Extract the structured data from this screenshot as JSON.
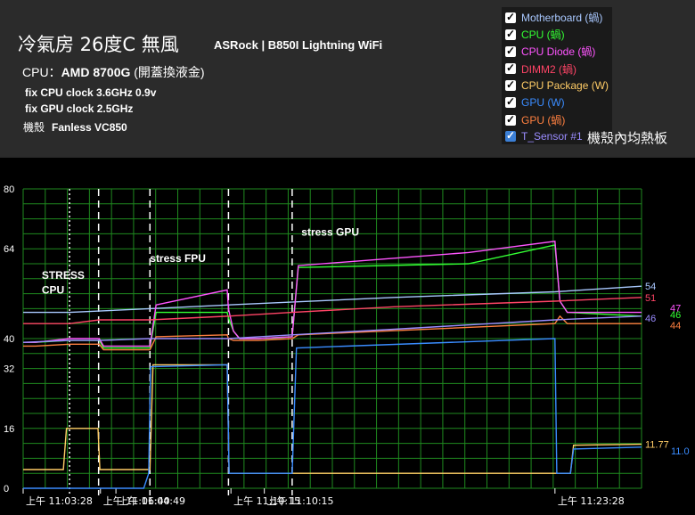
{
  "header": {
    "title": "冷氣房 26度C 無風",
    "board": "ASRock | B850I Lightning WiFi",
    "cpu_label": "CPU：",
    "cpu_model": "AMD 8700G",
    "cpu_cooler": "(開蓋換液金)",
    "line1": "fix CPU clock 3.6GHz  0.9v",
    "line2": "fix GPU clock 2.5GHz",
    "case_label": "機殼",
    "case_value": "Fanless VC850",
    "sensor_note": "機殼內均熱板"
  },
  "legend": [
    {
      "label": "Motherboard (蝸)",
      "color": "#a9c8ff",
      "checked": true
    },
    {
      "label": "CPU (蝸)",
      "color": "#33ff33",
      "checked": true
    },
    {
      "label": "CPU Diode (蝸)",
      "color": "#ff55ff",
      "checked": true
    },
    {
      "label": "DIMM2 (蝸)",
      "color": "#ff4466",
      "checked": true
    },
    {
      "label": "CPU Package (W)",
      "color": "#ffcc66",
      "checked": true
    },
    {
      "label": "GPU (W)",
      "color": "#3a8cff",
      "checked": true
    },
    {
      "label": "GPU (蝸)",
      "color": "#ff8040",
      "checked": true
    },
    {
      "label": "T_Sensor #1",
      "color": "#9a8cff",
      "checked": true
    }
  ],
  "chart_data": {
    "type": "line",
    "xlim": [
      0,
      100
    ],
    "ylim": [
      0,
      80
    ],
    "yticks": [
      0,
      16,
      32,
      40,
      64,
      80
    ],
    "x_tick_labels": [
      {
        "x": 0,
        "label": "上午 11:03:28"
      },
      {
        "x": 12.5,
        "label": "上午 11:06:40"
      },
      {
        "x": 15,
        "label": "上午 11:04:49"
      },
      {
        "x": 33.6,
        "label": "上午 11:10:15"
      },
      {
        "x": 39,
        "label": "上午 11:10:15"
      },
      {
        "x": 86,
        "label": "上午 11:23:28"
      }
    ],
    "annotations": [
      {
        "text": "STRESS",
        "x": 3,
        "y": 56
      },
      {
        "text": "CPU",
        "x": 3,
        "y": 52
      },
      {
        "text": "stress FPU",
        "x": 20.5,
        "y": 60.5
      },
      {
        "text": "stress  GPU",
        "x": 45,
        "y": 67.5
      }
    ],
    "markers": [
      {
        "x": 7.5,
        "style": "dotted"
      },
      {
        "x": 12.2,
        "style": "dashed"
      },
      {
        "x": 20.5,
        "style": "dashed"
      },
      {
        "x": 33.2,
        "style": "dashed"
      },
      {
        "x": 43.5,
        "style": "dashed"
      }
    ],
    "end_labels": [
      {
        "text": "54",
        "y": 54,
        "color": "#a9c8ff"
      },
      {
        "text": "51",
        "y": 51,
        "color": "#ff4466"
      },
      {
        "text": "47",
        "y": 47,
        "color": "#ff55ff"
      },
      {
        "text": "46",
        "y": 46,
        "color": "#33ff33"
      },
      {
        "text": "46",
        "y": 45.5,
        "color": "#9a8cff"
      },
      {
        "text": "44",
        "y": 44,
        "color": "#ff8040"
      },
      {
        "text": "11.77",
        "y": 11.77,
        "color": "#ffcc66"
      },
      {
        "text": "11.0",
        "y": 11.0,
        "color": "#3a8cff"
      }
    ],
    "series": [
      {
        "name": "Motherboard (蝸)",
        "color": "#a9c8ff",
        "x": [
          0,
          7.5,
          20.5,
          33.2,
          60,
          86,
          100
        ],
        "y": [
          47,
          47,
          48,
          49,
          51,
          52.5,
          54
        ]
      },
      {
        "name": "CPU (蝸)",
        "color": "#33ff33",
        "x": [
          0,
          2,
          7.5,
          12.3,
          13,
          20.5,
          21.5,
          33,
          33.2,
          34,
          35,
          38,
          43.5,
          44.5,
          72,
          86,
          86.8,
          88,
          100
        ],
        "y": [
          39,
          39,
          39.5,
          39.5,
          37.5,
          37.5,
          47,
          47,
          45.5,
          42,
          40,
          40,
          40.5,
          59,
          60,
          65,
          50,
          47,
          46
        ]
      },
      {
        "name": "CPU Diode (蝸)",
        "color": "#ff55ff",
        "x": [
          0,
          2,
          7.5,
          12.3,
          13,
          20.5,
          21.5,
          33,
          33.2,
          34,
          35,
          38,
          43.5,
          44.5,
          72,
          86,
          86.8,
          88,
          100
        ],
        "y": [
          39,
          39,
          40,
          40,
          38,
          38,
          49,
          53,
          48,
          42,
          40,
          40,
          40.5,
          59.5,
          63,
          66,
          50,
          47,
          47
        ]
      },
      {
        "name": "DIMM2 (蝸)",
        "color": "#ff4466",
        "x": [
          0,
          7.5,
          12.3,
          20.5,
          33.2,
          43.5,
          60,
          86,
          100
        ],
        "y": [
          44,
          44,
          45,
          45,
          46,
          47,
          48.5,
          50,
          51
        ]
      },
      {
        "name": "CPU Package (W)",
        "color": "#ffcc66",
        "x": [
          0,
          6.5,
          7,
          12.1,
          12.4,
          20.5,
          21,
          33,
          33.3,
          43.3,
          43.6,
          86,
          86.4,
          88.5,
          89,
          100
        ],
        "y": [
          5,
          5,
          16,
          16,
          5,
          5,
          33,
          33,
          4,
          4,
          4,
          4,
          4,
          4,
          11.5,
          11.77
        ]
      },
      {
        "name": "GPU (W)",
        "color": "#3a8cff",
        "x": [
          0,
          7.5,
          12.2,
          19.5,
          20.3,
          20.6,
          33,
          33.3,
          43.5,
          44.2,
          86,
          86.3,
          88.5,
          89,
          100
        ],
        "y": [
          0,
          0,
          0,
          0,
          4,
          32.5,
          33,
          4,
          4,
          37.5,
          40,
          4,
          4,
          10.5,
          11
        ]
      },
      {
        "name": "GPU (蝸)",
        "color": "#ff8040",
        "x": [
          0,
          2,
          7.5,
          12.3,
          13,
          20.5,
          21.5,
          33,
          33.2,
          34,
          38,
          43.5,
          44.5,
          86,
          86.8,
          88,
          100
        ],
        "y": [
          38,
          38,
          38.5,
          38.5,
          37,
          37,
          40.5,
          41,
          40,
          39.5,
          39.5,
          40,
          41,
          44,
          46,
          44,
          44
        ]
      },
      {
        "name": "T_Sensor #1",
        "color": "#9a8cff",
        "x": [
          0,
          7.5,
          12.3,
          20.5,
          33.2,
          43.5,
          60,
          86,
          100
        ],
        "y": [
          39,
          39.5,
          39.5,
          40,
          40,
          41,
          42.5,
          45,
          46
        ]
      }
    ]
  }
}
